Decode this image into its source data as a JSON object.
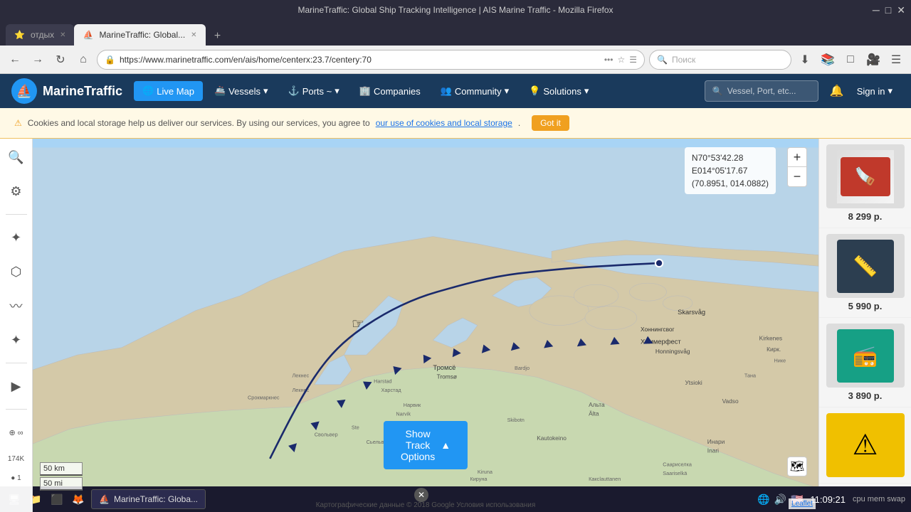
{
  "window": {
    "title": "MarineTraffic: Global Ship Tracking Intelligence | AIS Marine Traffic - Mozilla Firefox",
    "controls": [
      "─",
      "□",
      "✕"
    ]
  },
  "browser": {
    "tabs": [
      {
        "label": "отдых",
        "active": false,
        "id": "tab1"
      },
      {
        "label": "MarineTraffic: Global...",
        "active": true,
        "id": "tab2"
      }
    ],
    "new_tab": "+",
    "address": "https://www.marinetraffic.com/en/ais/home/centerx:23.7/centery:70",
    "search_placeholder": "Поиск"
  },
  "navbar": {
    "logo_text": "MarineTraffic",
    "items": [
      {
        "label": "Live Map",
        "active": true,
        "icon": "🌐"
      },
      {
        "label": "Vessels",
        "active": false,
        "icon": "🚢",
        "has_arrow": true
      },
      {
        "label": "Ports ~",
        "active": false,
        "icon": "⚓",
        "has_arrow": true
      },
      {
        "label": "Companies",
        "active": false,
        "icon": "🏢"
      },
      {
        "label": "Community",
        "active": false,
        "icon": "👥",
        "has_arrow": true
      },
      {
        "label": "Solutions",
        "active": false,
        "icon": "💡",
        "has_arrow": true
      }
    ],
    "search_placeholder": "Vessel, Port, etc...",
    "sign_in": "Sign in",
    "bell_icon": "🔔"
  },
  "cookie_banner": {
    "icon": "⚠",
    "text": "Cookies and local storage help us deliver our services. By using our services, you agree to",
    "link_text": "our use of cookies and local storage",
    "period": ".",
    "button": "Got it"
  },
  "sidebar": {
    "icons": [
      "🔍",
      "⚙",
      "✦",
      "⬡",
      "〰",
      "✦",
      "▶"
    ],
    "counters": [
      "∞",
      "174K",
      "1"
    ]
  },
  "map": {
    "coords": {
      "lat": "N70°53'42.28",
      "lon": "E014°05'17.67",
      "decimal": "(70.8951, 014.0882)"
    },
    "scale": {
      "km": "50 km",
      "mi": "50 mi"
    },
    "attribution": "Leaflet",
    "credit": "Картографические данные © 2018 Google   Условия использования"
  },
  "track_options": {
    "button_label": "Show Track Options",
    "icon": "▲",
    "close": "✕"
  },
  "ads": [
    {
      "price": "8 299 р.",
      "color": "#c0392b"
    },
    {
      "price": "5 990 р.",
      "color": "#2c3e50"
    },
    {
      "price": "3 890 р.",
      "color": "#16a085"
    },
    {
      "price": "",
      "color": "#f0c000",
      "is_warning": true
    }
  ],
  "taskbar": {
    "apps": [
      "MarineTraffic: Globa..."
    ],
    "system": {
      "time": "11:09:21",
      "label": "cpu mem swap"
    }
  }
}
